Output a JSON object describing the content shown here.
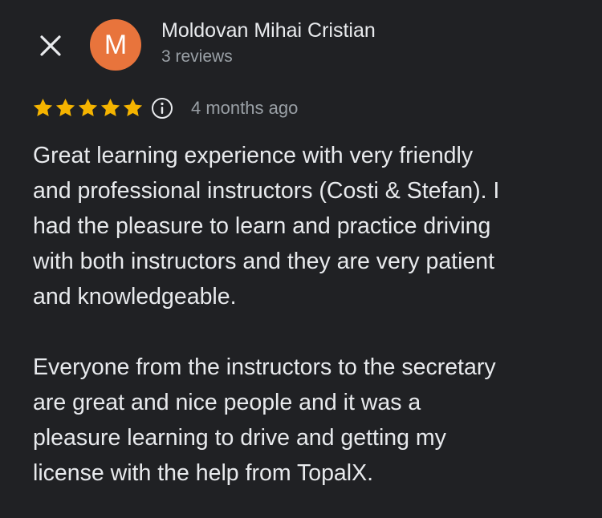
{
  "reviewer": {
    "initial": "M",
    "name": "Moldovan Mihai Cristian",
    "reviews": "3 reviews",
    "avatar_color": "#e8743c"
  },
  "rating": {
    "stars": 5,
    "max": 5,
    "star_color": "#f5b400",
    "time_ago": "4 months ago"
  },
  "body": {
    "paragraph1_lines": [
      "Great learning experience with very friendly",
      "and professional instructors (Costi & Stefan). I",
      "had the pleasure to learn and practice driving",
      "with both instructors and they are very patient",
      "and knowledgeable."
    ],
    "paragraph2_lines": [
      "Everyone from the instructors to the secretary",
      "are great and nice people and it was a",
      "pleasure learning to drive and getting my",
      "license with the help from TopalX."
    ]
  },
  "icons": {
    "close": "close-icon",
    "star": "star-icon",
    "info": "info-icon"
  },
  "colors": {
    "background": "#202124",
    "text_primary": "#e8eaed",
    "text_secondary": "#9aa0a6"
  }
}
